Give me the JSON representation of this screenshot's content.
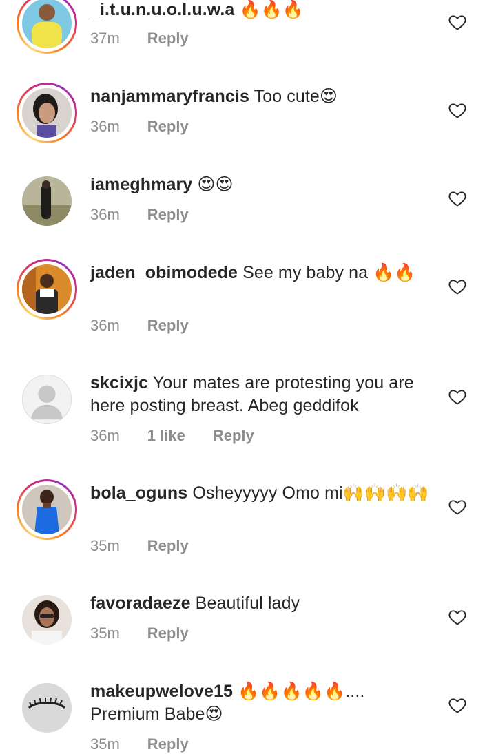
{
  "comments": [
    {
      "username": "_i.t.u.n.u.o.l.u.w.a",
      "text": "🔥🔥🔥",
      "time": "37m",
      "likes": "",
      "reply": "Reply",
      "avatar": "avatar-yellow-photo"
    },
    {
      "username": "nanjammaryfrancis",
      "text": "Too cute😍",
      "time": "36m",
      "likes": "",
      "reply": "Reply",
      "avatar": "avatar-woman-portrait"
    },
    {
      "username": "iameghmary",
      "text": "😍😍",
      "time": "36m",
      "likes": "",
      "reply": "Reply",
      "avatar": "avatar-outdoor-photo"
    },
    {
      "username": "jaden_obimodede",
      "text": "See my baby na 🔥🔥",
      "time": "36m",
      "likes": "",
      "reply": "Reply",
      "avatar": "avatar-chef-photo"
    },
    {
      "username": "skcixjc",
      "text": "Your mates are protesting you are here posting breast. Abeg geddifok",
      "time": "36m",
      "likes": "1 like",
      "reply": "Reply",
      "avatar": "avatar-default-silhouette"
    },
    {
      "username": "bola_oguns",
      "text": "Osheyyyyy Omo mi🙌🙌🙌🙌",
      "time": "35m",
      "likes": "",
      "reply": "Reply",
      "avatar": "avatar-blue-dress-photo"
    },
    {
      "username": "favoradaeze",
      "text": "Beautiful lady",
      "time": "35m",
      "likes": "",
      "reply": "Reply",
      "avatar": "avatar-glasses-photo"
    },
    {
      "username": "makeupwelove15",
      "text": "🔥🔥🔥🔥🔥.... Premium Babe😍",
      "time": "35m",
      "likes": "",
      "reply": "Reply",
      "avatar": "avatar-eyelashes-art"
    }
  ],
  "icons": {
    "like": "heart-outline-icon"
  },
  "colors": {
    "text": "#262626",
    "meta": "#8e8e8e",
    "story_ring_start": "#feda75",
    "story_ring_end": "#d62976"
  }
}
